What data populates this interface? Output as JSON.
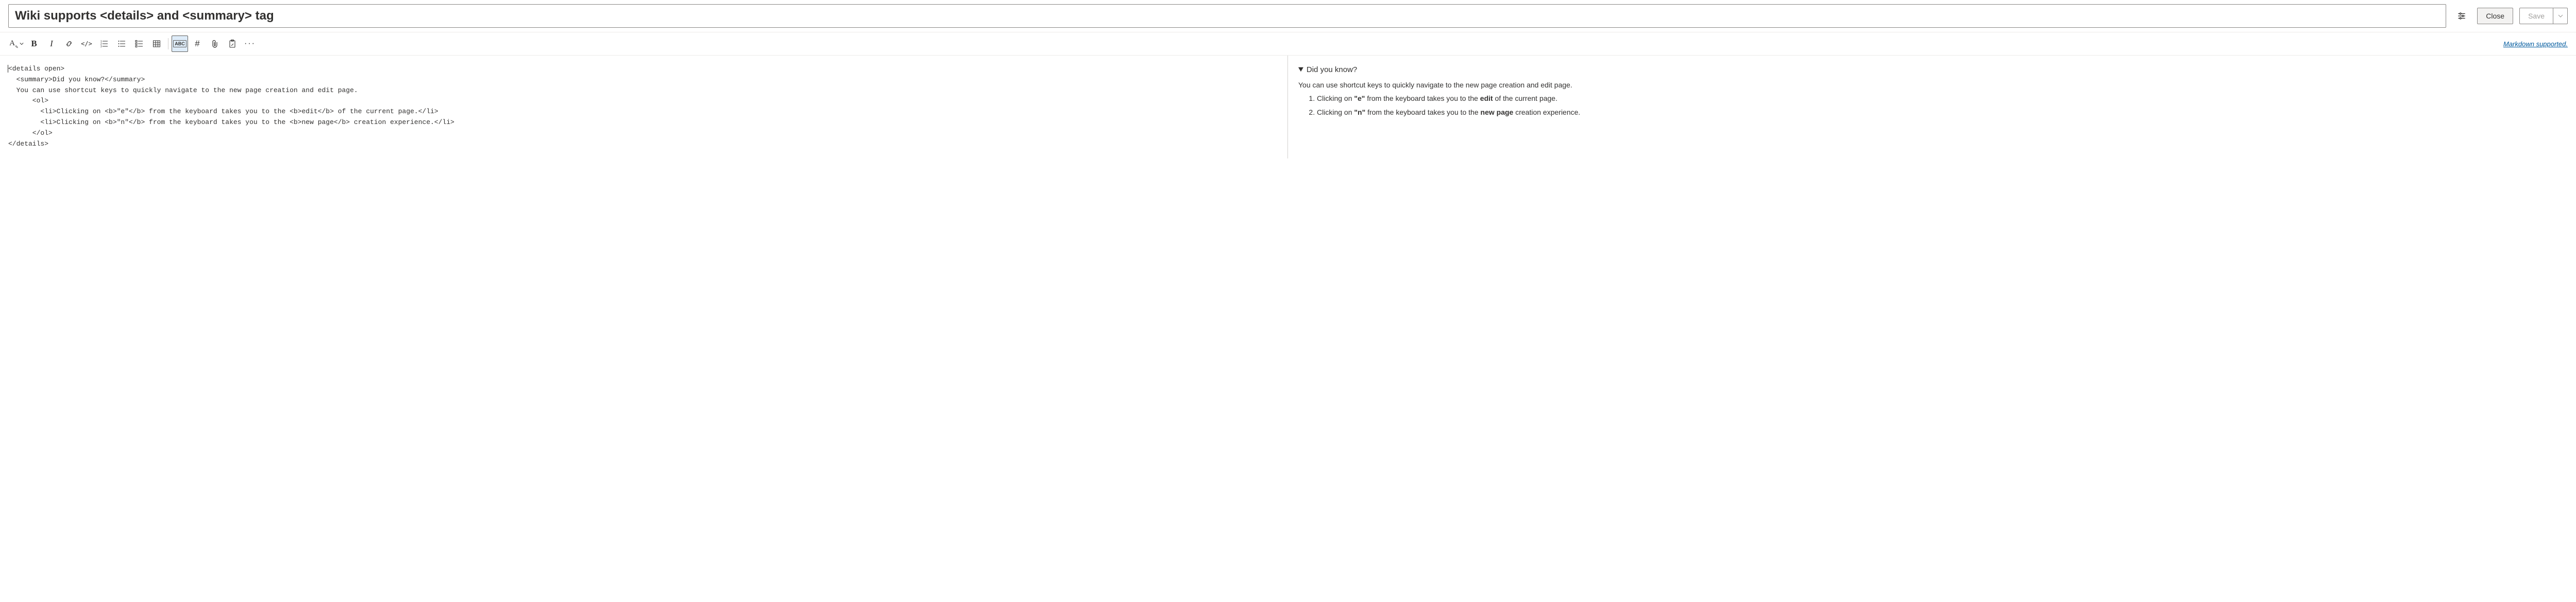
{
  "header": {
    "title": "Wiki supports <details> and <summary> tag",
    "close_label": "Close",
    "save_label": "Save"
  },
  "toolbar": {
    "markdown_supported_label": "Markdown supported.",
    "font_color_label": "A",
    "bold_label": "B",
    "italic_label": "I",
    "code_span_label": "</>",
    "abc_label": "ABC",
    "hash_label": "#",
    "more_label": "···"
  },
  "editor": {
    "lines": [
      "<details open>",
      "  <summary>Did you know?</summary>",
      "  You can use shortcut keys to quickly navigate to the new page creation and edit page.",
      "      <ol>",
      "        <li>Clicking on <b>\"e\"</b> from the keyboard takes you to the <b>edit</b> of the current page.</li>",
      "        <li>Clicking on <b>\"n\"</b> from the keyboard takes you to the <b>new page</b> creation experience.</li>",
      "      </ol>",
      "</details>"
    ]
  },
  "preview": {
    "summary": "Did you know?",
    "intro": "You can use shortcut keys to quickly navigate to the new page creation and edit page.",
    "item1_a": "Clicking on ",
    "item1_b": "\"e\"",
    "item1_c": " from the keyboard takes you to the ",
    "item1_d": "edit",
    "item1_e": " of the current page.",
    "item2_a": "Clicking on ",
    "item2_b": "\"n\"",
    "item2_c": " from the keyboard takes you to the ",
    "item2_d": "new page",
    "item2_e": " creation experience."
  }
}
